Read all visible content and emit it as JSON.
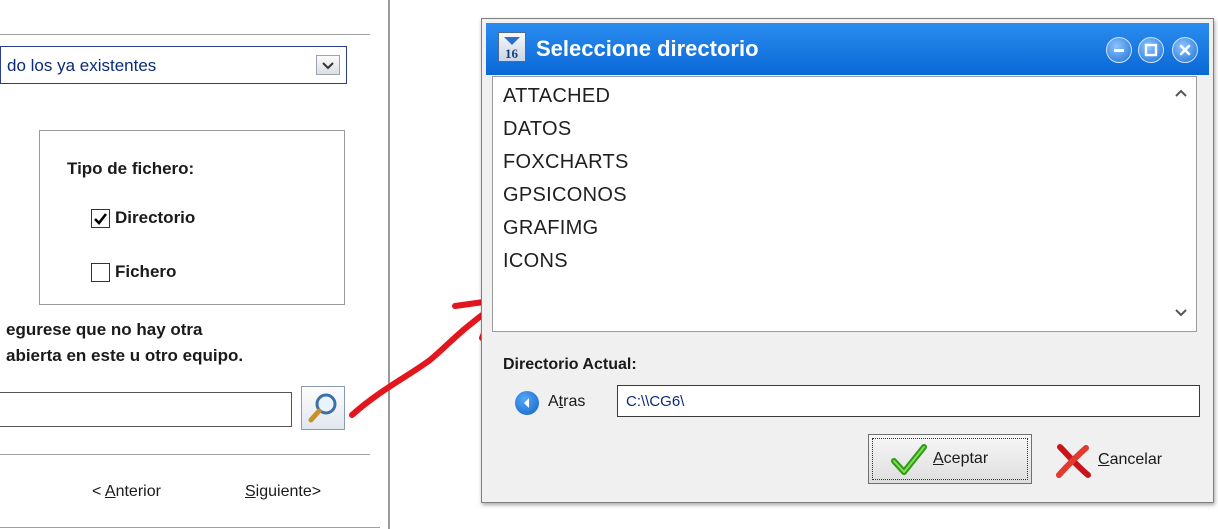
{
  "wizard": {
    "combo_value": "do los ya existentes",
    "filetype_label": "Tipo de fichero:",
    "option_directory": "Directorio",
    "option_directory_checked": true,
    "option_file": "Fichero",
    "option_file_checked": false,
    "warning_line1": "egurese que no hay otra",
    "warning_line2": "abierta en este u otro equipo.",
    "path_value": "",
    "prev_prefix": "< ",
    "prev_key": "A",
    "prev_rest": "nterior",
    "next_key": "S",
    "next_rest": "iguiente>"
  },
  "dialog": {
    "title": "Seleccione directorio",
    "directories": [
      "ATTACHED",
      "DATOS",
      "FOXCHARTS",
      "GPSICONOS",
      "GRAFIMG",
      "ICONS"
    ],
    "current_dir_label": "Directorio Actual:",
    "back_prefix": "A",
    "back_key": "t",
    "back_rest": "ras",
    "current_dir_value": "C:\\\\CG6\\",
    "accept_key": "A",
    "accept_rest": "ceptar",
    "cancel_key": "C",
    "cancel_rest": "ancelar"
  },
  "colors": {
    "titlebar": "#0a68d6",
    "annotation_arrow": "#e3151d"
  },
  "icons": {
    "combo": "chevron-down-icon",
    "search": "magnifier-icon",
    "back": "back-arrow-icon",
    "accept": "green-check-icon",
    "cancel": "red-x-icon"
  }
}
